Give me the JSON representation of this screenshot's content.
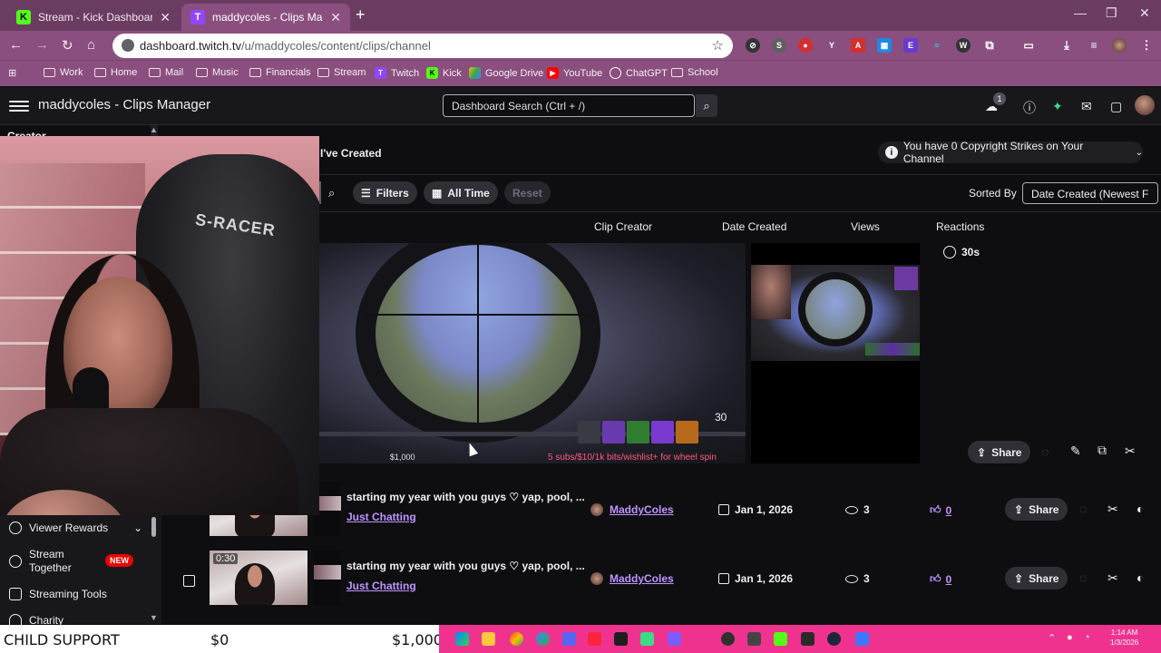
{
  "browser": {
    "tabs": [
      {
        "title": "Stream - Kick Dashboard",
        "favicon": "K"
      },
      {
        "title": "maddycoles - Clips Manager - T",
        "favicon": "T"
      }
    ],
    "url_host": "dashboard.twitch.tv",
    "url_path": "/u/maddycoles/content/clips/channel",
    "bookmarks": [
      "Work",
      "Home",
      "Mail",
      "Music",
      "Financials",
      "Stream",
      "Twitch",
      "Kick",
      "Google Drive",
      "YouTube",
      "ChatGPT",
      "School"
    ],
    "colors": {
      "chrome": "#8a4f7f",
      "tabbar": "#6b3c62"
    }
  },
  "header": {
    "title": "maddycoles - Clips Manager",
    "search_placeholder": "Dashboard Search (Ctrl + /)",
    "notification_count": "1"
  },
  "sidebar": {
    "partial_label": "Creator",
    "items": [
      {
        "label": "Viewer Rewards",
        "icon": "smile-icon"
      },
      {
        "label": "Stream Together",
        "icon": "people-icon",
        "badge": "NEW"
      },
      {
        "label": "Streaming Tools",
        "icon": "camera-icon"
      },
      {
        "label": "Charity",
        "icon": "heart-icon"
      }
    ]
  },
  "content": {
    "section_title": "I've Created",
    "strikes_notice": "You have 0 Copyright Strikes on Your Channel",
    "filters_label": "Filters",
    "time_label": "All Time",
    "reset_label": "Reset",
    "sorted_by_label": "Sorted By",
    "sort_value": "Date Created (Newest F",
    "columns": [
      "Clip Creator",
      "Date Created",
      "Views",
      "Reactions"
    ],
    "expanded": {
      "duration": "30s",
      "player_counter": "30",
      "player_ticker": "5 subs/$10/1k bits/wishlist+ for wheel spin",
      "player_money": "$1,000",
      "share_label": "Share"
    },
    "rows": [
      {
        "duration": "",
        "title": "starting my year with you guys ♡ yap, pool, ...",
        "category": "Just Chatting",
        "creator": "MaddyColes",
        "date": "Jan 1, 2026",
        "views": "3",
        "reactions": "0",
        "share_label": "Share"
      },
      {
        "duration": "0:30",
        "title": "starting my year with you guys ♡ yap, pool, ...",
        "category": "Just Chatting",
        "creator": "MaddyColes",
        "date": "Jan 1, 2026",
        "views": "3",
        "reactions": "0",
        "share_label": "Share"
      }
    ]
  },
  "overlay": {
    "goal_label": "CHILD SUPPORT",
    "goal_current": "$0",
    "goal_target": "$1,000"
  },
  "taskbar": {
    "time": "1:14 AM",
    "date": "1/3/2026"
  }
}
